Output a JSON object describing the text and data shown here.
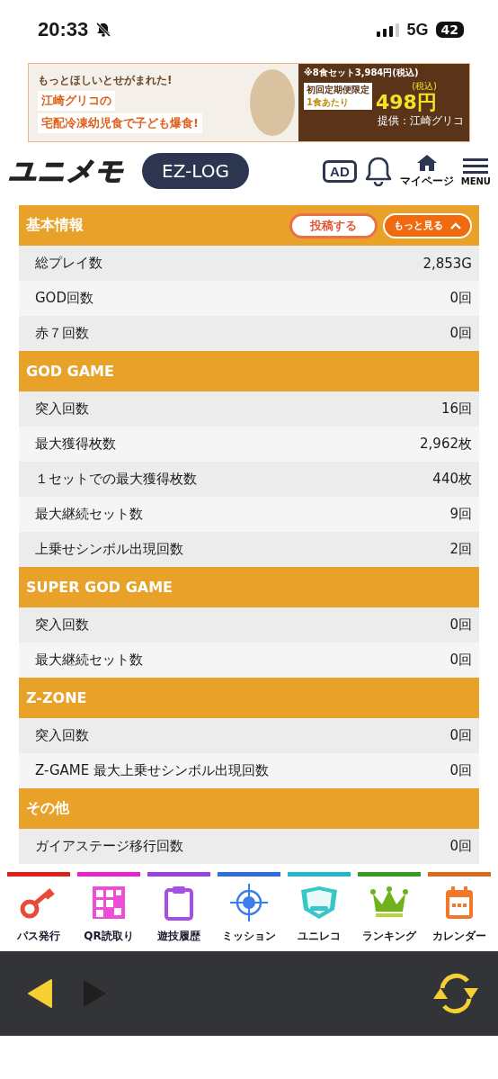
{
  "status_bar": {
    "time": "20:33",
    "network": "5G",
    "battery": "42"
  },
  "ad_banner": {
    "bubble": "もっとほしいとせがまれた!",
    "brand": "江崎グリコの",
    "headline": "宅配冷凍幼児食で子ども爆食!",
    "set_price": "※8食セット3,984円(税込)",
    "limited": "初回定期便限定",
    "per_meal": "1食あたり",
    "price": "498円",
    "tax": "(税込)",
    "sponsor": "提供：江崎グリコ"
  },
  "header": {
    "logo": "ユニメモ",
    "ez_log": "EZ-LOG",
    "ad": "AD",
    "mypage": "マイページ",
    "menu": "MENU"
  },
  "sections": [
    {
      "title": "基本情報",
      "post_button": "投稿する",
      "more_button": "もっと見る",
      "rows": [
        {
          "label": "総プレイ数",
          "value": "2,853G"
        },
        {
          "label": "GOD回数",
          "value": "0回"
        },
        {
          "label": "赤７回数",
          "value": "0回"
        }
      ]
    },
    {
      "title": "GOD GAME",
      "rows": [
        {
          "label": "突入回数",
          "value": "16回"
        },
        {
          "label": "最大獲得枚数",
          "value": "2,962枚"
        },
        {
          "label": "１セットでの最大獲得枚数",
          "value": "440枚"
        },
        {
          "label": "最大継続セット数",
          "value": "9回"
        },
        {
          "label": "上乗せシンボル出現回数",
          "value": "2回"
        }
      ]
    },
    {
      "title": "SUPER GOD GAME",
      "rows": [
        {
          "label": "突入回数",
          "value": "0回"
        },
        {
          "label": "最大継続セット数",
          "value": "0回"
        }
      ]
    },
    {
      "title": "Z-ZONE",
      "rows": [
        {
          "label": "突入回数",
          "value": "0回"
        },
        {
          "label": "Z-GAME 最大上乗せシンボル出現回数",
          "value": "0回"
        }
      ]
    },
    {
      "title": "その他",
      "rows": [
        {
          "label": "ガイアステージ移行回数",
          "value": "0回"
        }
      ]
    }
  ],
  "bottom_nav": [
    {
      "label": "パス発行",
      "kind": "key",
      "color": "#e0201e"
    },
    {
      "label": "QR読取り",
      "kind": "qr",
      "color": "#e824c8"
    },
    {
      "label": "遊技履歴",
      "kind": "clipboard",
      "color": "#9a42e0"
    },
    {
      "label": "ミッション",
      "kind": "target",
      "color": "#2f6ee0"
    },
    {
      "label": "ユニレコ",
      "kind": "emblem",
      "color": "#22b8c8"
    },
    {
      "label": "ランキング",
      "kind": "crown",
      "color": "#3a9a20"
    },
    {
      "label": "カレンダー",
      "kind": "calendar",
      "color": "#e0661a"
    }
  ]
}
